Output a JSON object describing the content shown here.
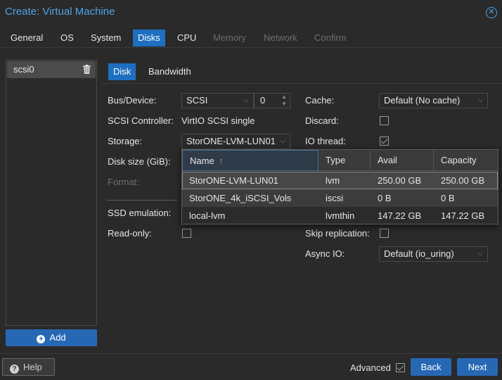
{
  "window": {
    "title": "Create: Virtual Machine",
    "close_glyph": "✕"
  },
  "tabs": [
    {
      "label": "General",
      "state": "normal"
    },
    {
      "label": "OS",
      "state": "normal"
    },
    {
      "label": "System",
      "state": "normal"
    },
    {
      "label": "Disks",
      "state": "active"
    },
    {
      "label": "CPU",
      "state": "normal"
    },
    {
      "label": "Memory",
      "state": "disabled"
    },
    {
      "label": "Network",
      "state": "disabled"
    },
    {
      "label": "Confirm",
      "state": "disabled"
    }
  ],
  "disk_list": {
    "items": [
      {
        "label": "scsi0",
        "icon": "trash-icon"
      }
    ],
    "add_label": "Add"
  },
  "subtabs": {
    "disk": "Disk",
    "bandwidth": "Bandwidth"
  },
  "form": {
    "bus_device_label": "Bus/Device:",
    "bus_value": "SCSI",
    "device_index": "0",
    "scsi_controller_label": "SCSI Controller:",
    "scsi_controller_value": "VirtIO SCSI single",
    "storage_label": "Storage:",
    "storage_value": "StorONE-LVM-LUN01",
    "disk_size_label": "Disk size (GiB):",
    "format_label": "Format:",
    "ssd_emulation_label": "SSD emulation:",
    "read_only_label": "Read-only:",
    "cache_label": "Cache:",
    "cache_value": "Default (No cache)",
    "discard_label": "Discard:",
    "io_thread_label": "IO thread:",
    "skip_replication_label": "Skip replication:",
    "async_io_label": "Async IO:",
    "async_io_value": "Default (io_uring)",
    "checks": {
      "discard": false,
      "io_thread": true,
      "read_only": false,
      "skip_replication": false
    }
  },
  "storage_dropdown": {
    "columns": [
      "Name",
      "Type",
      "Avail",
      "Capacity"
    ],
    "sort_indicator": "↑",
    "rows": [
      {
        "name": "StorONE-LVM-LUN01",
        "type": "lvm",
        "avail": "250.00 GB",
        "capacity": "250.00 GB"
      },
      {
        "name": "StorONE_4k_iSCSI_Vols",
        "type": "iscsi",
        "avail": "0 B",
        "capacity": "0 B"
      },
      {
        "name": "local-lvm",
        "type": "lvmthin",
        "avail": "147.22 GB",
        "capacity": "147.22 GB"
      }
    ]
  },
  "footer": {
    "help_label": "Help",
    "advanced_label": "Advanced",
    "advanced_checked": true,
    "back_label": "Back",
    "next_label": "Next"
  },
  "colors": {
    "accent": "#1e6fc0",
    "button": "#2768b5",
    "title": "#4ea3e6",
    "background": "#2a2a2a"
  }
}
